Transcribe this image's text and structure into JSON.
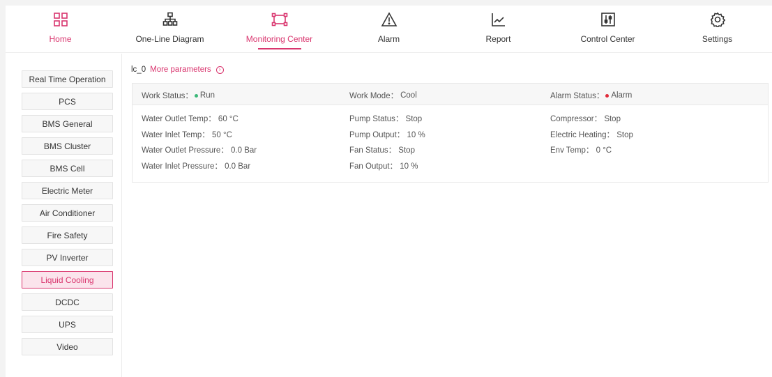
{
  "nav": [
    {
      "label": "Home",
      "icon": "home-grid-icon"
    },
    {
      "label": "One-Line Diagram",
      "icon": "one-line-diagram-icon"
    },
    {
      "label": "Monitoring Center",
      "icon": "monitoring-frame-icon"
    },
    {
      "label": "Alarm",
      "icon": "warning-triangle-icon"
    },
    {
      "label": "Report",
      "icon": "line-chart-icon"
    },
    {
      "label": "Control Center",
      "icon": "sliders-icon"
    },
    {
      "label": "Settings",
      "icon": "gear-icon"
    }
  ],
  "sidebar": [
    "Real Time Operation",
    "PCS",
    "BMS General",
    "BMS Cluster",
    "BMS Cell",
    "Electric Meter",
    "Air Conditioner",
    "Fire Safety",
    "PV Inverter",
    "Liquid Cooling",
    "DCDC",
    "UPS",
    "Video"
  ],
  "device": {
    "id": "lc_0",
    "more_label": "More parameters"
  },
  "status": {
    "work_status_label": "Work Status：",
    "work_status_value": "Run",
    "work_mode_label": "Work Mode：",
    "work_mode_value": "Cool",
    "alarm_status_label": "Alarm Status：",
    "alarm_status_value": "Alarm"
  },
  "params": {
    "col1": [
      "Water Outlet Temp：  60 °C",
      "Water Inlet Temp：  50 °C",
      "Water Outlet Pressure：  0.0 Bar",
      "Water Inlet Pressure：  0.0 Bar"
    ],
    "col2": [
      "Pump Status：  Stop",
      "Pump Output：  10 %",
      "Fan Status：  Stop",
      "Fan Output：  10 %"
    ],
    "col3": [
      "Compressor：  Stop",
      "Electric Heating：  Stop",
      "Env Temp：  0 °C"
    ]
  },
  "colors": {
    "accent": "#d9356e",
    "run": "#3cb878",
    "alarm": "#e02a3a"
  }
}
